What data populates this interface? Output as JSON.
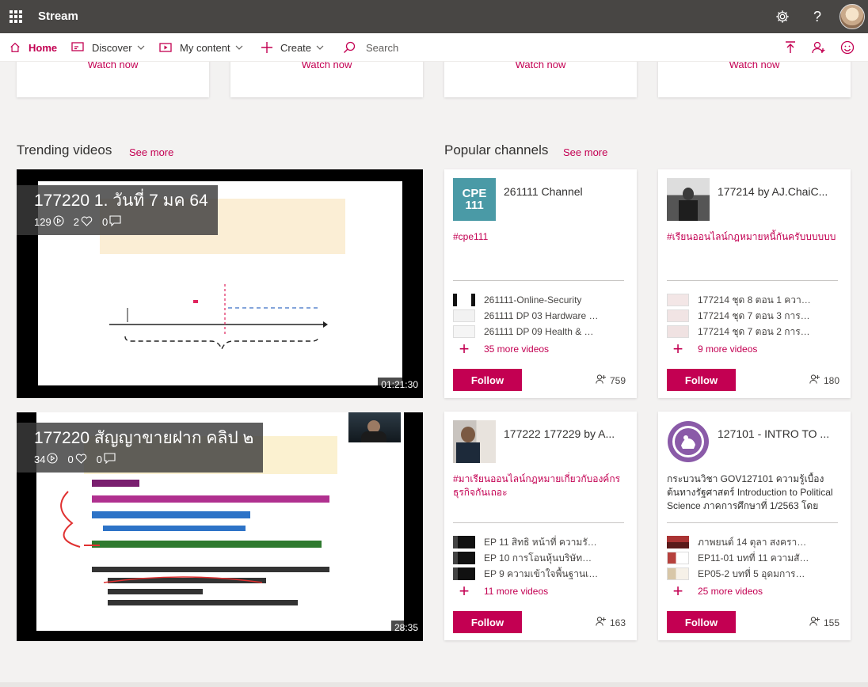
{
  "app": {
    "name": "Stream"
  },
  "nav": {
    "home": "Home",
    "discover": "Discover",
    "my_content": "My content",
    "create": "Create",
    "search_placeholder": "Search"
  },
  "top_cards": [
    "Watch now",
    "Watch now",
    "Watch now",
    "Watch now"
  ],
  "trending": {
    "title": "Trending videos",
    "see_more": "See more",
    "videos": [
      {
        "title": "177220 1. วันที่ 7 มค 64",
        "views": "129",
        "likes": "2",
        "comments": "0",
        "duration": "01:21:30"
      },
      {
        "title": "177220 สัญญาขายฝาก คลิป ๒",
        "views": "34",
        "likes": "0",
        "comments": "0",
        "duration": "28:35"
      }
    ]
  },
  "popular": {
    "title": "Popular channels",
    "see_more": "See more",
    "channels": [
      {
        "name": "261111 Channel",
        "thumb_text": "CPE 111",
        "description": "#cpe111",
        "videos": [
          "261111-Online-Security",
          "261111 DP 03 Hardware (...",
          "261111 DP 09 Health & G..."
        ],
        "more": "35 more videos",
        "follow": "Follow",
        "followers": "759"
      },
      {
        "name": "177214 by AJ.ChaiC...",
        "description": "#เรียนออนไลน์กฎหมายหนี้กันครับบบบบบ",
        "videos": [
          "177214 ชุด 8 ตอน 1 ความร...",
          "177214 ชุด 7 ตอน 3 การคุ้ม...",
          "177214 ชุด 7 ตอน 2 การคุ้ม..."
        ],
        "more": "9 more videos",
        "follow": "Follow",
        "followers": "180"
      },
      {
        "name": "177222 177229 by A...",
        "description": "#มาเรียนออนไลน์กฎหมายเกี่ยวกับองค์กรธุรกิจกันเถอะ",
        "videos": [
          "EP 11 สิทธิ หน้าที่ ความรับผิ...",
          "EP 10 การโอนหุ้นบริษัทจำกัด",
          "EP 9 ความเข้าใจพื้นฐานเกี่ย..."
        ],
        "more": "11 more videos",
        "follow": "Follow",
        "followers": "163"
      },
      {
        "name": "127101 - INTRO TO ...",
        "description": "กระบวนวิชา GOV127101 ความรู้เบื้องต้นทางรัฐศาสตร์ Introduction to Political Science ภาคการศึกษาที่ 1/2563 โดย",
        "videos": [
          "ภาพยนต์ 14 ตุลา สงครามปร...",
          "EP11-01 บทที่ 11 ความสัม...",
          "EP05-2 บทที่ 5 อุดมการณ์ท..."
        ],
        "more": "25 more videos",
        "follow": "Follow",
        "followers": "155"
      }
    ]
  },
  "colors": {
    "accent": "#c30052",
    "appbar": "#484644",
    "background": "#f3f2f1"
  }
}
